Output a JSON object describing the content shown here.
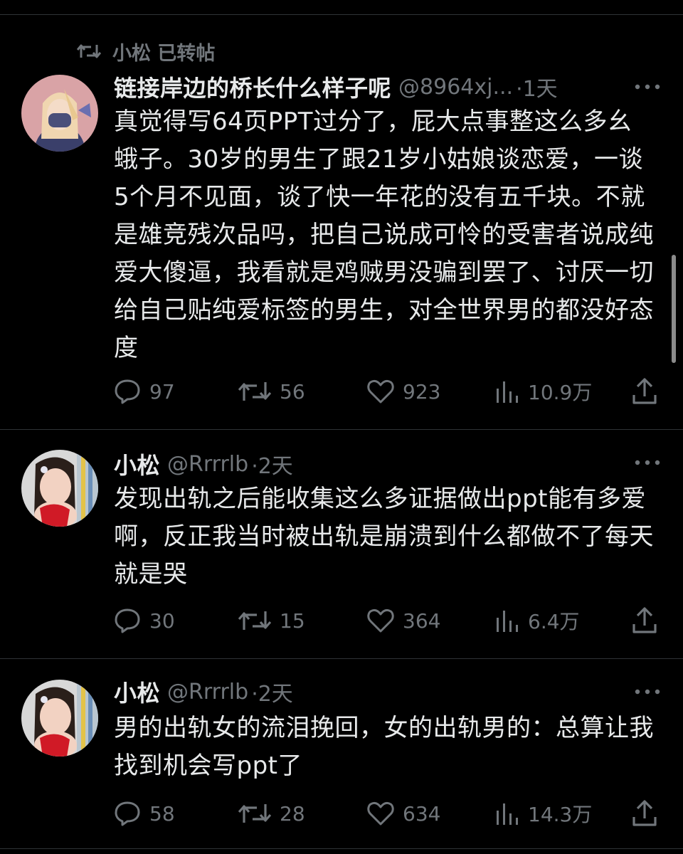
{
  "colors": {
    "background": "#000000",
    "text_primary": "#e7e9ea",
    "text_secondary": "#71767b",
    "divider": "#2f3336"
  },
  "repost_banner": {
    "icon": "repost-icon",
    "text": "小松 已转帖"
  },
  "tweets": [
    {
      "name": "链接岸边的桥长什么样子呢",
      "handle": "@8964xj...",
      "time": "·1天",
      "text": "真觉得写64页PPT过分了，屁大点事整这么多幺蛾子。30岁的男生了跟21岁小姑娘谈恋爱，一谈5个月不见面，谈了快一年花的没有五千块。不就是雄竞残次品吗，把自己说成可怜的受害者说成纯爱大傻逼，我看就是鸡贼男没骗到罢了、讨厌一切给自己贴纯爱标签的男生，对全世界男的都没好态度",
      "replies": "97",
      "reposts": "56",
      "likes": "923",
      "views": "10.9万"
    },
    {
      "name": "小松",
      "handle": "@Rrrrlb",
      "time": "·2天",
      "text": "发现出轨之后能收集这么多证据做出ppt能有多爱啊，反正我当时被出轨是崩溃到什么都做不了每天就是哭",
      "replies": "30",
      "reposts": "15",
      "likes": "364",
      "views": "6.4万"
    },
    {
      "name": "小松",
      "handle": "@Rrrrlb",
      "time": "·2天",
      "text": "男的出轨女的流泪挽回，女的出轨男的：总算让我找到机会写ppt了",
      "replies": "58",
      "reposts": "28",
      "likes": "634",
      "views": "14.3万"
    }
  ]
}
